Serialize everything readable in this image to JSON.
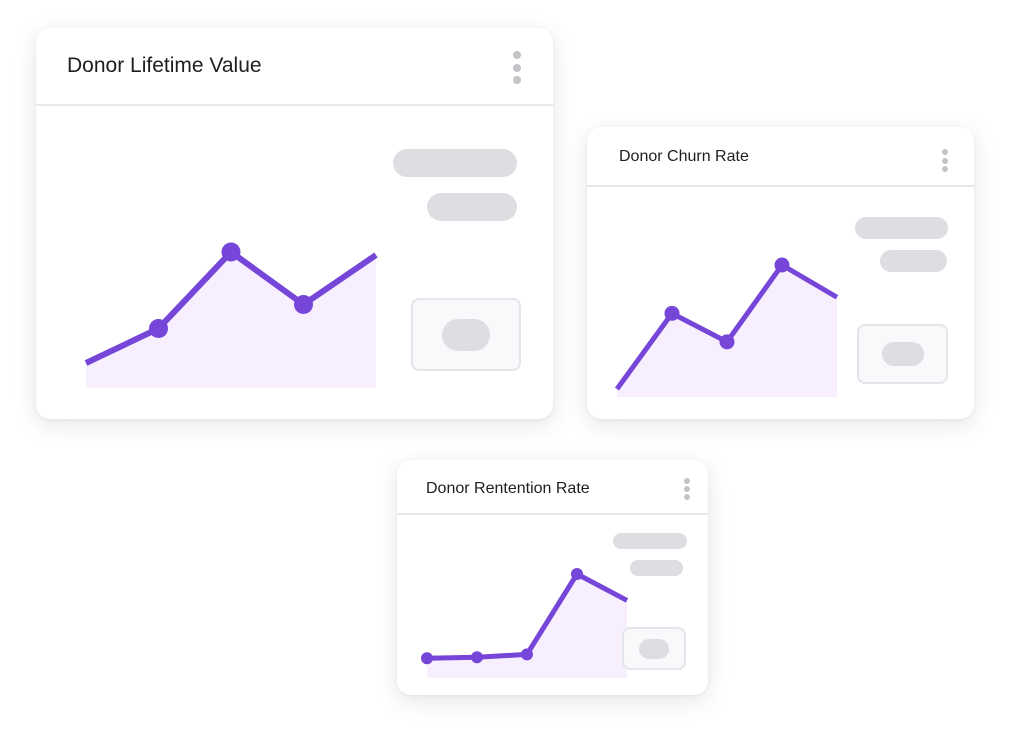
{
  "theme": {
    "line_color": "#7646d8",
    "area_color": "#f8effe",
    "skeleton_color": "#dcdee2"
  },
  "cards": [
    {
      "title": "Donor Lifetime Value",
      "menu_icon": "kebab-vertical-icon"
    },
    {
      "title": "Donor Churn Rate",
      "menu_icon": "kebab-vertical-icon"
    },
    {
      "title": "Donor Rentention Rate",
      "menu_icon": "kebab-vertical-icon"
    }
  ],
  "chart_data": [
    {
      "type": "area",
      "title": "Donor Lifetime Value",
      "x": [
        0,
        1,
        2,
        3,
        4
      ],
      "values": [
        10,
        33,
        84,
        49,
        82
      ],
      "markers": [
        false,
        true,
        true,
        true,
        false
      ],
      "ylim": [
        0,
        100
      ],
      "grid": false,
      "xlabel": "",
      "ylabel": ""
    },
    {
      "type": "area",
      "title": "Donor Churn Rate",
      "x": [
        0,
        1,
        2,
        3,
        4
      ],
      "values": [
        0,
        61,
        38,
        100,
        74
      ],
      "markers": [
        false,
        true,
        true,
        true,
        false
      ],
      "ylim": [
        0,
        100
      ],
      "grid": false,
      "xlabel": "",
      "ylabel": ""
    },
    {
      "type": "area",
      "title": "Donor Rentention Rate",
      "x": [
        0,
        1,
        2,
        3,
        4
      ],
      "values": [
        14,
        15,
        18,
        100,
        73
      ],
      "markers": [
        true,
        true,
        true,
        true,
        false
      ],
      "ylim": [
        0,
        100
      ],
      "grid": false,
      "xlabel": "",
      "ylabel": ""
    }
  ]
}
